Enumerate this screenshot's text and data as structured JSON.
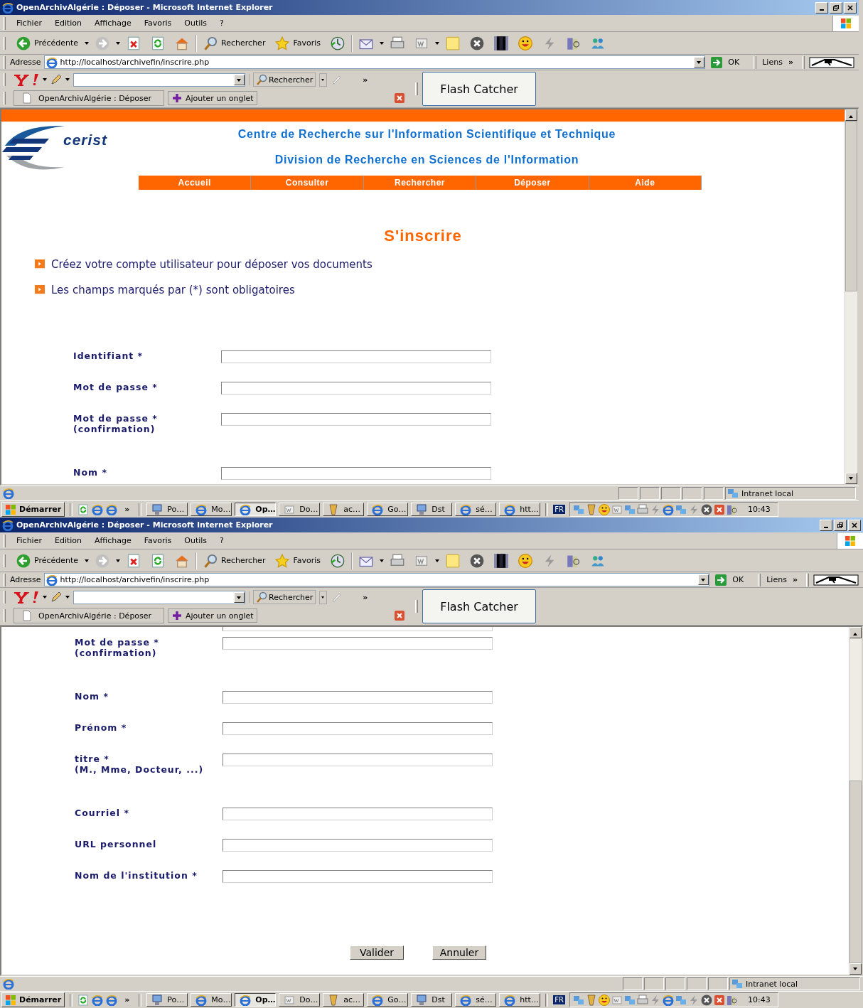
{
  "windows": [
    {
      "title": "OpenArchivAlgérie : Déposer - Microsoft Internet Explorer",
      "menu": [
        "Fichier",
        "Edition",
        "Affichage",
        "Favoris",
        "Outils",
        "?"
      ],
      "toolbar": {
        "back": "Précédente",
        "search": "Rechercher",
        "favorites": "Favoris"
      },
      "address": {
        "label": "Adresse",
        "url": "http://localhost/archivefin/inscrire.php",
        "go": "OK",
        "links": "Liens",
        "more": "»"
      },
      "yahoo": {
        "search": "Rechercher",
        "more": "»",
        "tab": "OpenArchivAlgérie : Déposer",
        "add_tab": "Ajouter un onglet",
        "flash": "Flash Catcher"
      },
      "page": {
        "header": true,
        "logo": "cerist",
        "lines": [
          "Centre de Recherche sur l'Information Scientifique et Technique",
          "Division de Recherche en Sciences de l'Information"
        ],
        "nav": [
          "Accueil",
          "Consulter",
          "Rechercher",
          "Déposer",
          "Aide"
        ],
        "heading": "S'inscrire",
        "notes": [
          "Créez votre compte utilisateur pour déposer vos documents",
          "Les champs marqués par (*) sont obligatoires"
        ],
        "groups": [
          [
            {
              "label": "Identifiant *"
            },
            {
              "label": "Mot de passe *"
            },
            {
              "label": "Mot de passe *",
              "note": "(confirmation)"
            }
          ],
          [
            {
              "label": "Nom *"
            }
          ]
        ]
      },
      "status": "Intranet local",
      "taskbar": {
        "start": "Démarrer",
        "more": "»",
        "tasks": [
          {
            "label": "Po…",
            "kind": "computer",
            "selected": false
          },
          {
            "label": "Mo…",
            "kind": "browser",
            "selected": false
          },
          {
            "label": "Op…",
            "kind": "browser",
            "selected": true
          },
          {
            "label": "Do…",
            "kind": "document",
            "selected": false
          },
          {
            "label": "ac…",
            "kind": "app",
            "selected": false
          },
          {
            "label": "Go…",
            "kind": "browser",
            "selected": false
          },
          {
            "label": "Dst",
            "kind": "computer",
            "selected": false
          },
          {
            "label": "sé…",
            "kind": "browser",
            "selected": false
          },
          {
            "label": "htt…",
            "kind": "browser",
            "selected": false
          }
        ],
        "lang": "FR",
        "clock": "10:43"
      }
    },
    {
      "title": "OpenArchivAlgérie : Déposer - Microsoft Internet Explorer",
      "menu": [
        "Fichier",
        "Edition",
        "Affichage",
        "Favoris",
        "Outils",
        "?"
      ],
      "toolbar": {
        "back": "Précédente",
        "search": "Rechercher",
        "favorites": "Favoris"
      },
      "address": {
        "label": "Adresse",
        "url": "http://localhost/archivefin/inscrire.php",
        "go": "OK",
        "links": "Liens",
        "more": "»"
      },
      "yahoo": {
        "search": "Rechercher",
        "more": "»",
        "tab": "OpenArchivAlgérie : Déposer",
        "add_tab": "Ajouter un onglet",
        "flash": "Flash Catcher"
      },
      "page": {
        "header": false,
        "groups": [
          [
            {
              "kind": "cut"
            },
            {
              "label": "Mot de passe *",
              "note": "(confirmation)"
            }
          ],
          [
            {
              "label": "Nom *"
            },
            {
              "label": "Prénom *"
            },
            {
              "label": "titre *",
              "note": "(M., Mme, Docteur, ...)"
            }
          ],
          [
            {
              "label": "Courriel *"
            },
            {
              "label": "URL personnel"
            },
            {
              "label": "Nom de l'institution *"
            }
          ]
        ],
        "buttons": [
          "Valider",
          "Annuler"
        ]
      },
      "status": "Intranet local",
      "taskbar": {
        "start": "Démarrer",
        "more": "»",
        "tasks": [
          {
            "label": "Po…",
            "kind": "computer",
            "selected": false
          },
          {
            "label": "Mo…",
            "kind": "browser",
            "selected": false
          },
          {
            "label": "Op…",
            "kind": "browser",
            "selected": true
          },
          {
            "label": "Do…",
            "kind": "document",
            "selected": false
          },
          {
            "label": "ac…",
            "kind": "app",
            "selected": false
          },
          {
            "label": "Go…",
            "kind": "browser",
            "selected": false
          },
          {
            "label": "Dst",
            "kind": "computer",
            "selected": false
          },
          {
            "label": "sé…",
            "kind": "browser",
            "selected": false
          },
          {
            "label": "htt…",
            "kind": "browser",
            "selected": false
          }
        ],
        "lang": "FR",
        "clock": "10:43"
      }
    }
  ]
}
